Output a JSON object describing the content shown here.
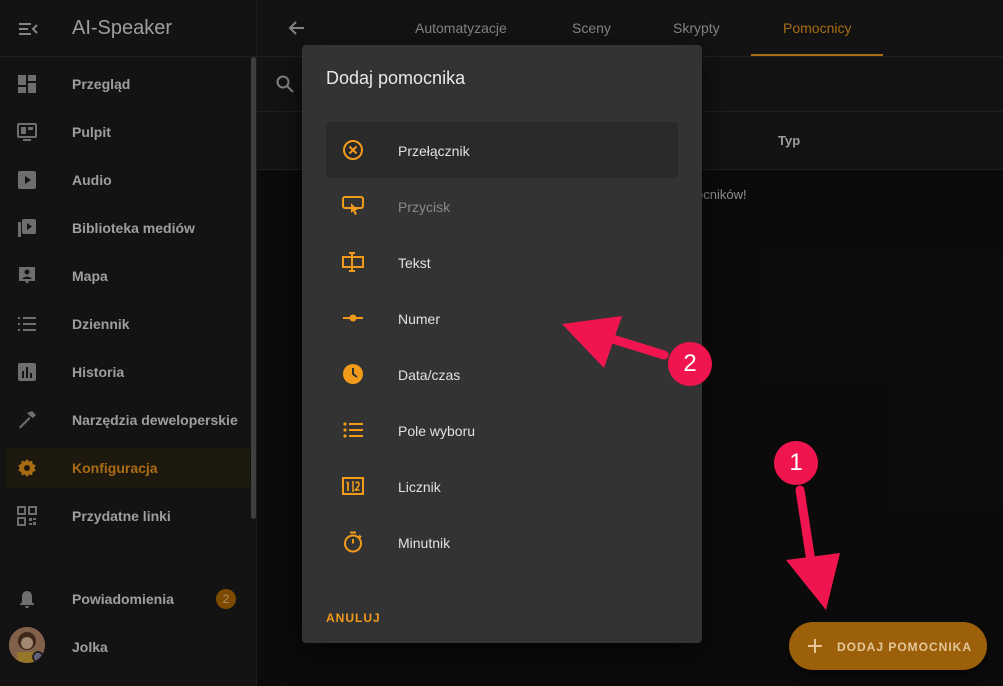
{
  "app": {
    "title": "AI-Speaker"
  },
  "colors": {
    "accent": "#f29b1b",
    "annotation": "#f0154e",
    "background": "#111111",
    "surface": "#1c1c1c",
    "dialog": "#333333"
  },
  "sidebar": {
    "items": [
      {
        "label": "Przegląd",
        "icon": "dashboard-icon"
      },
      {
        "label": "Pulpit",
        "icon": "monitor-dashboard-icon"
      },
      {
        "label": "Audio",
        "icon": "play-box-icon"
      },
      {
        "label": "Biblioteka mediów",
        "icon": "play-box-multiple-icon"
      },
      {
        "label": "Mapa",
        "icon": "account-box-icon"
      },
      {
        "label": "Dziennik",
        "icon": "format-list-bulleted-icon"
      },
      {
        "label": "Historia",
        "icon": "chart-box-icon"
      },
      {
        "label": "Narzędzia deweloperskie",
        "icon": "hammer-icon"
      },
      {
        "label": "Konfiguracja",
        "icon": "cog-icon",
        "active": true
      },
      {
        "label": "Przydatne linki",
        "icon": "qrcode-icon"
      }
    ],
    "notifications": {
      "label": "Powiadomienia",
      "count": "2"
    },
    "user": {
      "label": "Jolka"
    }
  },
  "tabs": [
    {
      "label": "Automatyzacje"
    },
    {
      "label": "Sceny"
    },
    {
      "label": "Skrypty"
    },
    {
      "label": "Pomocnicy",
      "active": true
    }
  ],
  "table": {
    "column_type": "Typ",
    "empty_message": "omocników!"
  },
  "dialog": {
    "title": "Dodaj pomocnika",
    "options": [
      {
        "label": "Przełącznik",
        "icon": "toggle-switch-icon"
      },
      {
        "label": "Przycisk",
        "icon": "gesture-tap-button-icon",
        "disabled": true
      },
      {
        "label": "Tekst",
        "icon": "form-textbox-icon"
      },
      {
        "label": "Numer",
        "icon": "ray-vertex-icon"
      },
      {
        "label": "Data/czas",
        "icon": "clock-icon"
      },
      {
        "label": "Pole wyboru",
        "icon": "format-list-bulleted-icon"
      },
      {
        "label": "Licznik",
        "icon": "counter-icon"
      },
      {
        "label": "Minutnik",
        "icon": "timer-outline-icon"
      }
    ],
    "cancel_label": "ANULUJ"
  },
  "fab": {
    "label": "DODAJ POMOCNIKA"
  },
  "annotations": {
    "marker_1": "1",
    "marker_2": "2"
  }
}
